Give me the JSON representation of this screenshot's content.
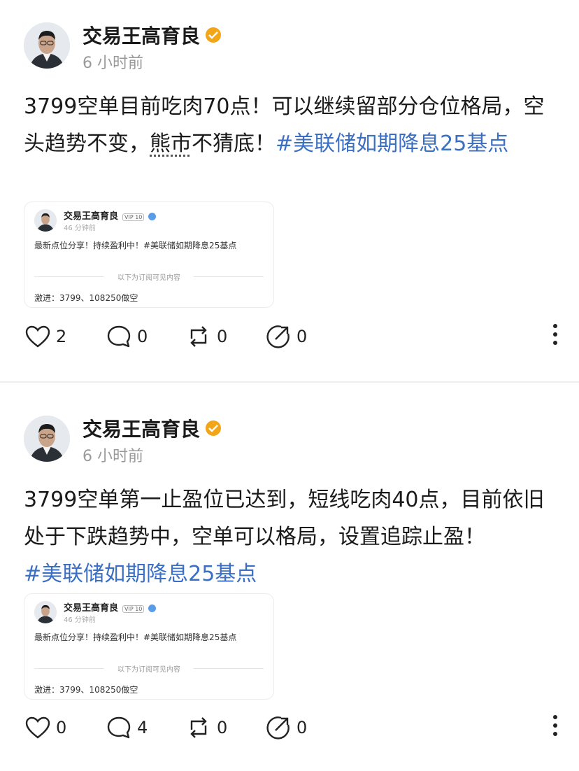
{
  "posts": [
    {
      "author": "交易王高育良",
      "time": "6 小时前",
      "text_part1": "3799空单目前吃肉70点！可以继续留部分仓位格局，空头趋势不变，",
      "text_dotted": "熊市",
      "text_part2": "不猜底！",
      "hashtag": "#美联储如期降息25基点",
      "quote": {
        "author": "交易王高育良",
        "vip": "VIP 10",
        "time": "46 分钟前",
        "text": "最新点位分享！持续盈利中！#美联储如期降息25基点",
        "separator": "以下为订阅可见内容",
        "footer": "激进：3799、108250做空"
      },
      "likes": "2",
      "comments": "0",
      "reposts": "0",
      "shares": "0"
    },
    {
      "author": "交易王高育良",
      "time": "6 小时前",
      "text_part1": "3799空单第一止盈位已达到，短线吃肉40点，目前依旧处于下跌趋势中，空单可以格局，设置追踪止盈！",
      "hashtag": "#美联储如期降息25基点",
      "quote": {
        "author": "交易王高育良",
        "vip": "VIP 10",
        "time": "46 分钟前",
        "text": "最新点位分享！持续盈利中！#美联储如期降息25基点",
        "separator": "以下为订阅可见内容",
        "footer": "激进：3799、108250做空"
      },
      "likes": "0",
      "comments": "4",
      "reposts": "0",
      "shares": "0"
    }
  ],
  "colors": {
    "hashtag": "#3a6fc4",
    "verified": "#f2a516",
    "divider": "#eeeeee"
  },
  "icons": [
    "verified-badge-icon",
    "heart-icon",
    "comment-icon",
    "repost-icon",
    "share-icon",
    "more-icon"
  ]
}
